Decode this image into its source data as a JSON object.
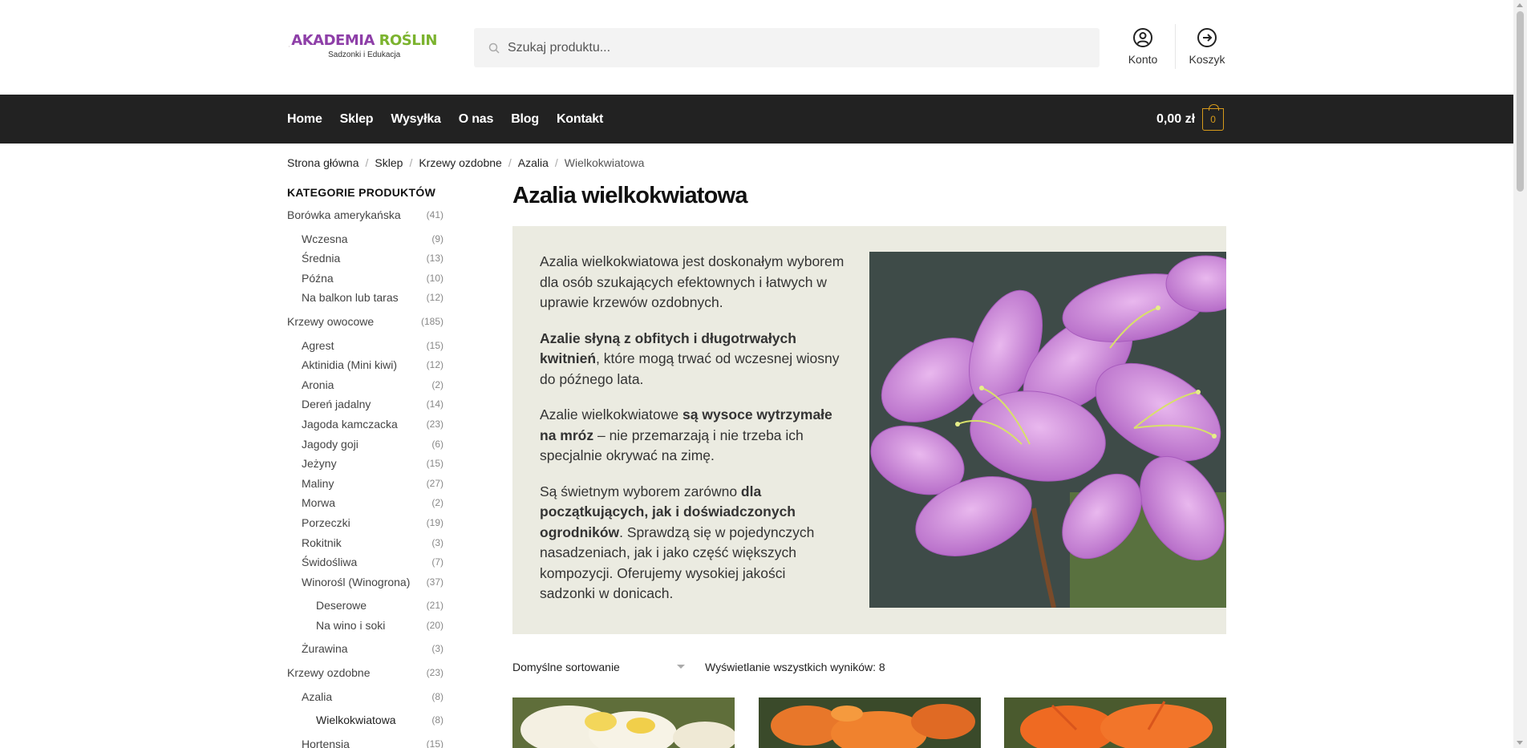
{
  "header": {
    "logo_title_a": "AKADEMIA ",
    "logo_title_b": "ROŚLIN",
    "logo_subtitle": "Sadzonki i Edukacja",
    "search_placeholder": "Szukaj produktu...",
    "account_label": "Konto",
    "cart_link_label": "Koszyk"
  },
  "nav": {
    "items": [
      {
        "label": "Home"
      },
      {
        "label": "Sklep"
      },
      {
        "label": "Wysyłka"
      },
      {
        "label": "O nas"
      },
      {
        "label": "Blog"
      },
      {
        "label": "Kontakt"
      }
    ],
    "cart_total": "0,00 zł",
    "cart_count": "0"
  },
  "breadcrumb": {
    "items": [
      "Strona główna",
      "Sklep",
      "Krzewy ozdobne",
      "Azalia"
    ],
    "separator": "/",
    "current": "Wielkokwiatowa"
  },
  "sidebar": {
    "title": "KATEGORIE PRODUKTÓW",
    "categories": [
      {
        "name": "Borówka amerykańska",
        "count": "(41)",
        "level": 0
      },
      {
        "name": "Wczesna",
        "count": "(9)",
        "level": 1
      },
      {
        "name": "Średnia",
        "count": "(13)",
        "level": 1
      },
      {
        "name": "Późna",
        "count": "(10)",
        "level": 1
      },
      {
        "name": "Na balkon lub taras",
        "count": "(12)",
        "level": 1
      },
      {
        "name": "Krzewy owocowe",
        "count": "(185)",
        "level": 0
      },
      {
        "name": "Agrest",
        "count": "(15)",
        "level": 1
      },
      {
        "name": "Aktinidia (Mini kiwi)",
        "count": "(12)",
        "level": 1
      },
      {
        "name": "Aronia",
        "count": "(2)",
        "level": 1
      },
      {
        "name": "Dereń jadalny",
        "count": "(14)",
        "level": 1
      },
      {
        "name": "Jagoda kamczacka",
        "count": "(23)",
        "level": 1
      },
      {
        "name": "Jagody goji",
        "count": "(6)",
        "level": 1
      },
      {
        "name": "Jeżyny",
        "count": "(15)",
        "level": 1
      },
      {
        "name": "Maliny",
        "count": "(27)",
        "level": 1
      },
      {
        "name": "Morwa",
        "count": "(2)",
        "level": 1
      },
      {
        "name": "Porzeczki",
        "count": "(19)",
        "level": 1
      },
      {
        "name": "Rokitnik",
        "count": "(3)",
        "level": 1
      },
      {
        "name": "Świdośliwa",
        "count": "(7)",
        "level": 1
      },
      {
        "name": "Winorośl (Winogrona)",
        "count": "(37)",
        "level": 1
      },
      {
        "name": "Deserowe",
        "count": "(21)",
        "level": 2
      },
      {
        "name": "Na wino i soki",
        "count": "(20)",
        "level": 2
      },
      {
        "name": "Żurawina",
        "count": "(3)",
        "level": 1
      },
      {
        "name": "Krzewy ozdobne",
        "count": "(23)",
        "level": 0
      },
      {
        "name": "Azalia",
        "count": "(8)",
        "level": 1
      },
      {
        "name": "Wielkokwiatowa",
        "count": "(8)",
        "level": 2
      },
      {
        "name": "Hortensja",
        "count": "(15)",
        "level": 1
      }
    ]
  },
  "product_category": {
    "title": "Azalia wielkokwiatowa",
    "p1": "Azalia wielkokwiatowa jest doskonałym wyborem dla osób szukających efektownych i łatwych w uprawie krzewów ozdobnych.",
    "p2_bold": "Azalie słyną z obfitych i długotrwałych kwitnień",
    "p2_rest": ", które mogą trwać od wczesnej wiosny do późnego lata.",
    "p3_a": "Azalie wielkokwiatowe ",
    "p3_bold": "są wysoce wytrzymałe na mróz",
    "p3_rest": " – nie przemarzają i nie trzeba ich specjalnie okrywać na zimę.",
    "p4_a": "Są świetnym wyborem zarówno ",
    "p4_bold": "dla początkujących, jak i doświadczonych ogrodników",
    "p4_rest": ". Sprawdzą się w pojedynczych nasadzeniach, jak i jako część większych kompozycji. Oferujemy wysokiej jakości sadzonki w donicach."
  },
  "listing": {
    "sort_label": "Domyślne sortowanie",
    "results_text": "Wyświetlanie wszystkich wyników: 8"
  },
  "colors": {
    "nav_bg": "#222222",
    "accent": "#d69a1b",
    "desc_bg": "#ebebe1",
    "logo_purple": "#8e3fa8",
    "logo_green": "#7bb32e"
  }
}
